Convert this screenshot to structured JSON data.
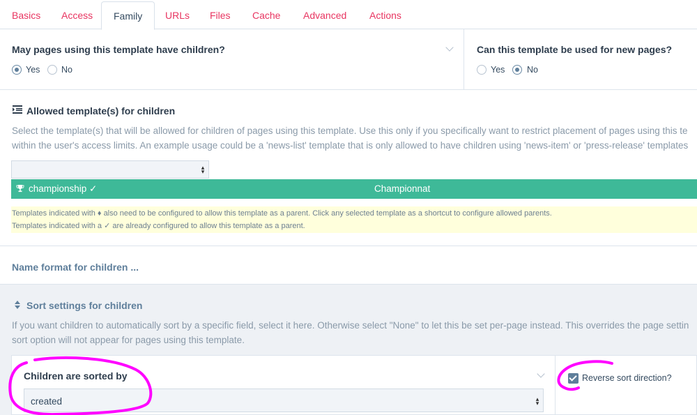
{
  "tabs": [
    {
      "label": "Basics"
    },
    {
      "label": "Access"
    },
    {
      "label": "Family"
    },
    {
      "label": "URLs"
    },
    {
      "label": "Files"
    },
    {
      "label": "Cache"
    },
    {
      "label": "Advanced"
    },
    {
      "label": "Actions"
    }
  ],
  "active_tab": "Family",
  "children_field": {
    "title": "May pages using this template have children?",
    "yes": "Yes",
    "no": "No",
    "selected": "Yes"
  },
  "new_pages_field": {
    "title": "Can this template be used for new pages?",
    "yes": "Yes",
    "no": "No",
    "selected": "No"
  },
  "allowed_templates": {
    "title": "Allowed template(s) for children",
    "icon": "list-icon",
    "desc_line1": "Select the template(s) that will be allowed for children of pages using this template. Use this only if you specifically want to restrict placement of pages using this te",
    "desc_line2": "within the user's access limits. An example usage could be a 'news-list' template that is only allowed to have children using 'news-item' or 'press-release' templates",
    "select_value": "",
    "item": {
      "name": "championship ✓",
      "label": "Championnat",
      "icon": "trophy-icon"
    },
    "note1": "Templates indicated with ♦ also need to be configured to allow this template as a parent. Click any selected template as a shortcut to configure allowed parents.",
    "note2": "Templates indicated with a ✓ are already configured to allow this template as a parent."
  },
  "name_format": {
    "title": "Name format for children ..."
  },
  "sort_settings": {
    "title": "Sort settings for children",
    "icon": "sort-icon",
    "desc_line1": "If you want children to automatically sort by a specific field, select it here. Otherwise select \"None\" to let this be set per-page instead. This overrides the page settin",
    "desc_line2": "sort option will not appear for pages using this template.",
    "sorted_by_label": "Children are sorted by",
    "sorted_by_value": "created",
    "reverse_label": "Reverse sort direction?",
    "reverse_checked": true
  },
  "colors": {
    "tab_link": "#e83561",
    "green": "#3eb998",
    "note_bg": "#ffffdc",
    "annotation": "#ff00ff"
  }
}
